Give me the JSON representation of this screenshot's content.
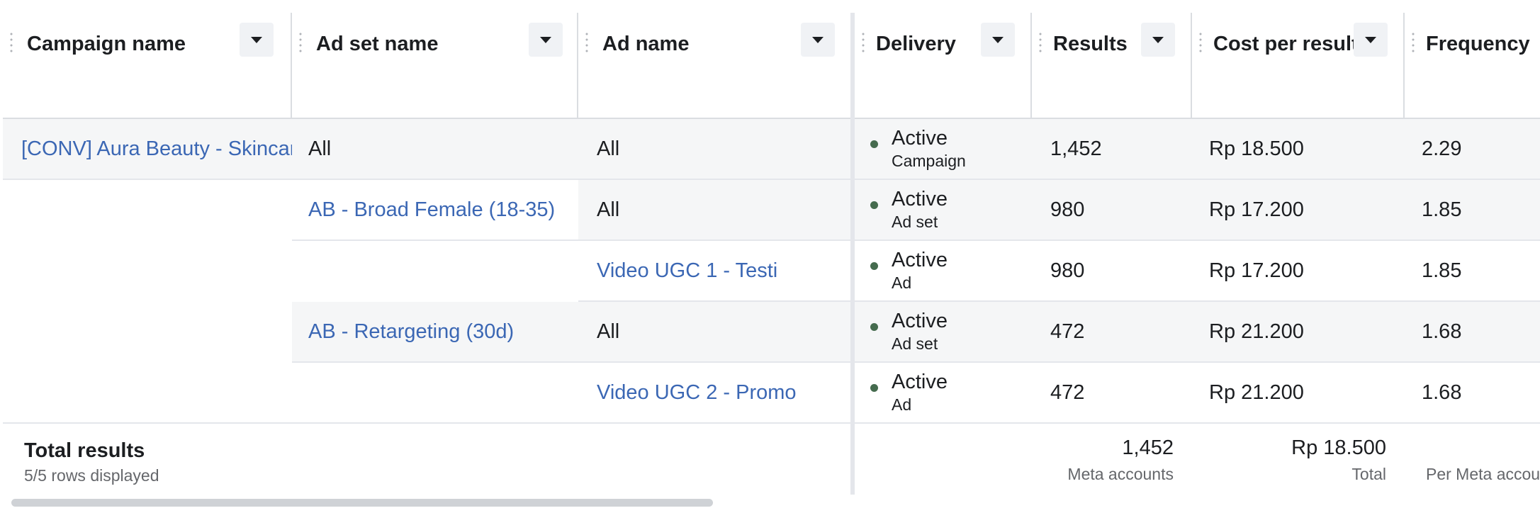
{
  "columns": {
    "campaign_name": "Campaign name",
    "ad_set_name": "Ad set name",
    "ad_name": "Ad name",
    "delivery": "Delivery",
    "results": "Results",
    "cost_per_result": "Cost per result",
    "frequency": "Frequency"
  },
  "rows": [
    {
      "campaign": "[CONV] Aura Beauty - Skincare",
      "ad_set": "All",
      "ad": "All",
      "status": "Active",
      "level": "Campaign",
      "results": "1,452",
      "cost": "Rp 18.500",
      "frequency": "2.29"
    },
    {
      "campaign": "",
      "ad_set": "AB - Broad Female (18-35)",
      "ad": "All",
      "status": "Active",
      "level": "Ad set",
      "results": "980",
      "cost": "Rp 17.200",
      "frequency": "1.85"
    },
    {
      "campaign": "",
      "ad_set": "",
      "ad": "Video UGC 1 - Testi",
      "status": "Active",
      "level": "Ad",
      "results": "980",
      "cost": "Rp 17.200",
      "frequency": "1.85"
    },
    {
      "campaign": "",
      "ad_set": "AB - Retargeting (30d)",
      "ad": "All",
      "status": "Active",
      "level": "Ad set",
      "results": "472",
      "cost": "Rp 21.200",
      "frequency": "1.68"
    },
    {
      "campaign": "",
      "ad_set": "",
      "ad": "Video UGC 2 - Promo",
      "status": "Active",
      "level": "Ad",
      "results": "472",
      "cost": "Rp 21.200",
      "frequency": "1.68"
    }
  ],
  "totals": {
    "label": "Total results",
    "rows_displayed": "5/5 rows displayed",
    "results": "1,452",
    "results_sub": "Meta accounts",
    "cost": "Rp 18.500",
    "cost_sub": "Total",
    "frequency_sub": "Per Meta accounts"
  },
  "colors": {
    "link": "#3b67b4",
    "status_dot": "#456b4e",
    "header_button": "#f0f2f5"
  },
  "icons": {
    "column_menu": "caret-down-icon",
    "column_grip": "drag-handle-icon"
  }
}
